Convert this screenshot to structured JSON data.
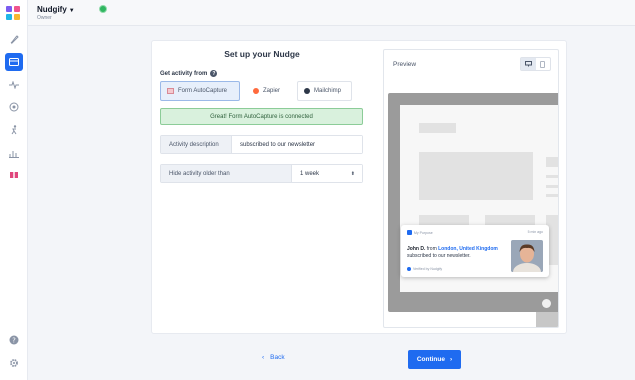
{
  "header": {
    "brand": "Nudgify",
    "role": "Owner"
  },
  "sidebar": {
    "icons": [
      "rocket-icon",
      "card-icon",
      "pulse-icon",
      "target-icon",
      "runner-icon",
      "bar-chart-icon",
      "gift-icon",
      "help-icon",
      "gear-icon"
    ],
    "active_index": 1
  },
  "setup": {
    "title": "Set up your Nudge",
    "activity_label": "Get activity from",
    "sources": [
      {
        "label": "Form AutoCapture",
        "selected": true
      },
      {
        "label": "Zapier",
        "selected": false
      },
      {
        "label": "Mailchimp",
        "selected": false
      }
    ],
    "alert": "Great! Form AutoCapture is connected",
    "description_label": "Activity description",
    "description_value": "subscribed to our newsletter",
    "hide_label": "Hide activity older than",
    "hide_value": "1 week"
  },
  "preview": {
    "title": "Preview",
    "nudge": {
      "source": "My Purpose",
      "time": "5 min ago",
      "name": "John D.",
      "from": "from",
      "location": "London, United Kingdom",
      "action": "subscribed to our newsletter.",
      "verified": "Verified by Nudgify"
    }
  },
  "footer": {
    "back_label": "Back",
    "continue_label": "Continue"
  },
  "colors": {
    "primary": "#1f6bf0",
    "success_bg": "#d9f1dd",
    "success_border": "#8ccc98"
  }
}
